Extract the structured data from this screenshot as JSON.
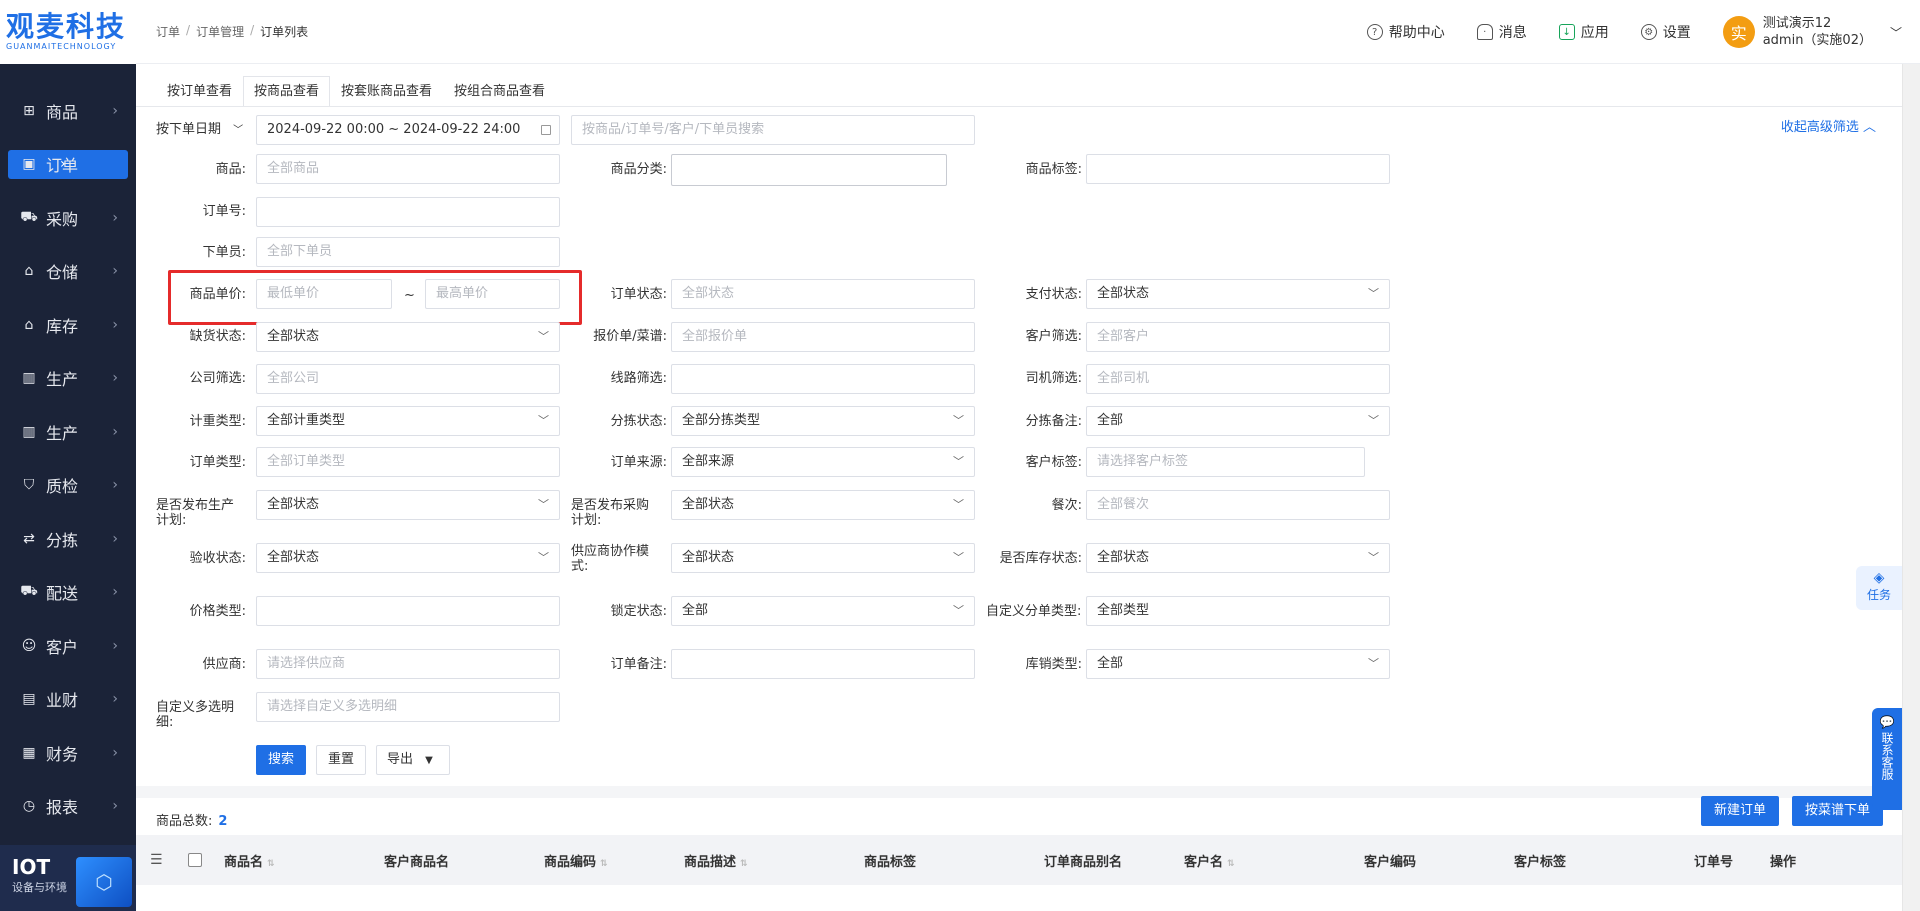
{
  "logo": {
    "main": "观麦科技",
    "sub": "GUANMAITECHNOLOGY"
  },
  "sidebar": {
    "items": [
      {
        "label": "商品",
        "icon": "grid-icon"
      },
      {
        "label": "订单",
        "icon": "order-icon",
        "active": true
      },
      {
        "label": "采购",
        "icon": "cart-icon"
      },
      {
        "label": "仓储",
        "icon": "warehouse-icon"
      },
      {
        "label": "库存",
        "icon": "inventory-icon"
      },
      {
        "label": "生产",
        "icon": "factory-icon"
      },
      {
        "label": "生产",
        "icon": "factory-icon"
      },
      {
        "label": "质检",
        "icon": "shield-icon"
      },
      {
        "label": "分拣",
        "icon": "sort-icon"
      },
      {
        "label": "配送",
        "icon": "truck-icon"
      },
      {
        "label": "客户",
        "icon": "user-icon"
      },
      {
        "label": "业财",
        "icon": "finance-chart-icon"
      },
      {
        "label": "财务",
        "icon": "finance-icon"
      },
      {
        "label": "报表",
        "icon": "report-icon"
      }
    ],
    "iot": {
      "title": "IOT",
      "sub": "设备与环境"
    }
  },
  "header": {
    "breadcrumb": [
      "订单",
      "订单管理",
      "订单列表"
    ],
    "help": "帮助中心",
    "messages": "消息",
    "apps": "应用",
    "settings": "设置",
    "user": {
      "avatar": "实",
      "name": "测试演示12",
      "account": "admin（实施02）"
    }
  },
  "tabs": [
    "按订单查看",
    "按商品查看",
    "按套账商品查看",
    "按组合商品查看"
  ],
  "filters": {
    "date_type": "按下单日期",
    "date_range": "2024-09-22 00:00 ~ 2024-09-22 24:00",
    "search_placeholder": "按商品/订单号/客户/下单员搜索",
    "collapse": "收起高级筛选",
    "product_label": "商品:",
    "product_ph": "全部商品",
    "category_label": "商品分类:",
    "tag_label": "商品标签:",
    "order_no_label": "订单号:",
    "orderer_label": "下单员:",
    "orderer_ph": "全部下单员",
    "price_label": "商品单价:",
    "price_min_ph": "最低单价",
    "price_max_ph": "最高单价",
    "price_sep": "~",
    "order_status_label": "订单状态:",
    "order_status_ph": "全部状态",
    "pay_status_label": "支付状态:",
    "pay_status_value": "全部状态",
    "stockout_label": "缺货状态:",
    "stockout_value": "全部状态",
    "quote_label": "报价单/菜谱:",
    "quote_ph": "全部报价单",
    "customer_label": "客户筛选:",
    "customer_ph": "全部客户",
    "company_label": "公司筛选:",
    "company_ph": "全部公司",
    "route_label": "线路筛选:",
    "driver_label": "司机筛选:",
    "driver_ph": "全部司机",
    "weigh_label": "计重类型:",
    "weigh_value": "全部计重类型",
    "sort_status_label": "分拣状态:",
    "sort_status_value": "全部分拣类型",
    "sort_note_label": "分拣备注:",
    "sort_note_value": "全部",
    "order_type_label": "订单类型:",
    "order_type_ph": "全部订单类型",
    "order_source_label": "订单来源:",
    "order_source_value": "全部来源",
    "cust_tag_label": "客户标签:",
    "cust_tag_ph": "请选择客户标签",
    "prod_plan_label": "是否发布生产计划:",
    "prod_plan_value": "全部状态",
    "purch_plan_label": "是否发布采购计划:",
    "purch_plan_value": "全部状态",
    "meal_label": "餐次:",
    "meal_ph": "全部餐次",
    "accept_label": "验收状态:",
    "accept_value": "全部状态",
    "supplier_mode_label": "供应商协作模式:",
    "supplier_mode_value": "全部状态",
    "stock_state_label": "是否库存状态:",
    "stock_state_value": "全部状态",
    "price_type_label": "价格类型:",
    "lock_label": "锁定状态:",
    "lock_value": "全部",
    "split_type_label": "自定义分单类型:",
    "split_type_value": "全部类型",
    "supplier_label": "供应商:",
    "supplier_ph": "请选择供应商",
    "order_note_label": "订单备注:",
    "stock_sale_label": "库销类型:",
    "stock_sale_value": "全部",
    "custom_multi_label": "自定义多选明细:",
    "custom_multi_ph": "请选择自定义多选明细"
  },
  "actions": {
    "search": "搜索",
    "reset": "重置",
    "export": "导出"
  },
  "summary": {
    "label": "商品总数:",
    "count": "2"
  },
  "list_actions": {
    "new_order": "新建订单",
    "by_menu": "按菜谱下单"
  },
  "table": {
    "columns": [
      "商品名",
      "客户商品名",
      "商品编码",
      "商品描述",
      "商品标签",
      "订单商品别名",
      "客户名",
      "客户编码",
      "客户标签",
      "订单号",
      "操作"
    ]
  },
  "floaters": {
    "task": "任务",
    "service": "联系客服"
  }
}
